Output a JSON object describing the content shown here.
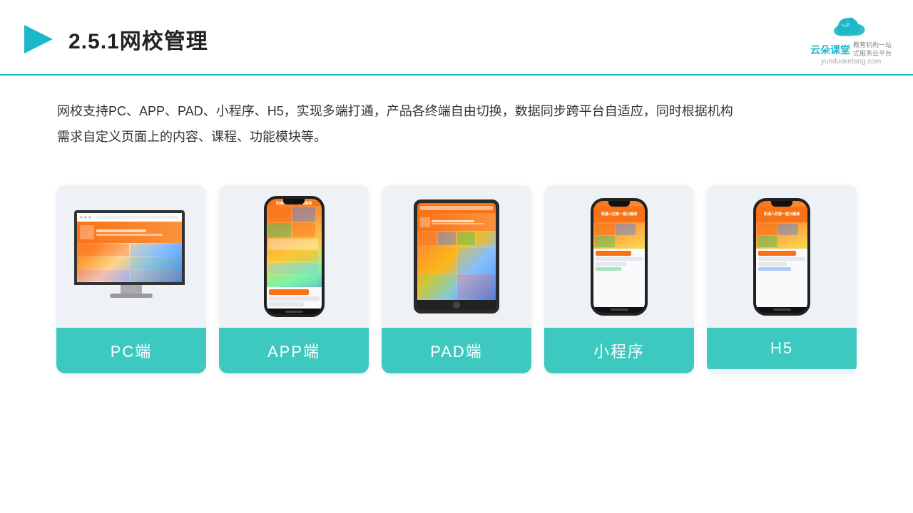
{
  "header": {
    "title": "2.5.1网校管理",
    "logo_name": "云朵课堂",
    "logo_url": "yunduoketang.com",
    "logo_tagline": "教育机构一站",
    "logo_tagline2": "式服务云平台"
  },
  "description": {
    "text": "网校支持PC、APP、PAD、小程序、H5，实现多端打通，产品各终端自由切换，数据同步跨平台自适应，同时根据机构需求自定义页面上的内容、课程、功能模块等。"
  },
  "cards": [
    {
      "id": "pc",
      "label": "PC端"
    },
    {
      "id": "app",
      "label": "APP端"
    },
    {
      "id": "pad",
      "label": "PAD端"
    },
    {
      "id": "miniprogram",
      "label": "小程序"
    },
    {
      "id": "h5",
      "label": "H5"
    }
  ],
  "accent_color": "#3dc8c0"
}
